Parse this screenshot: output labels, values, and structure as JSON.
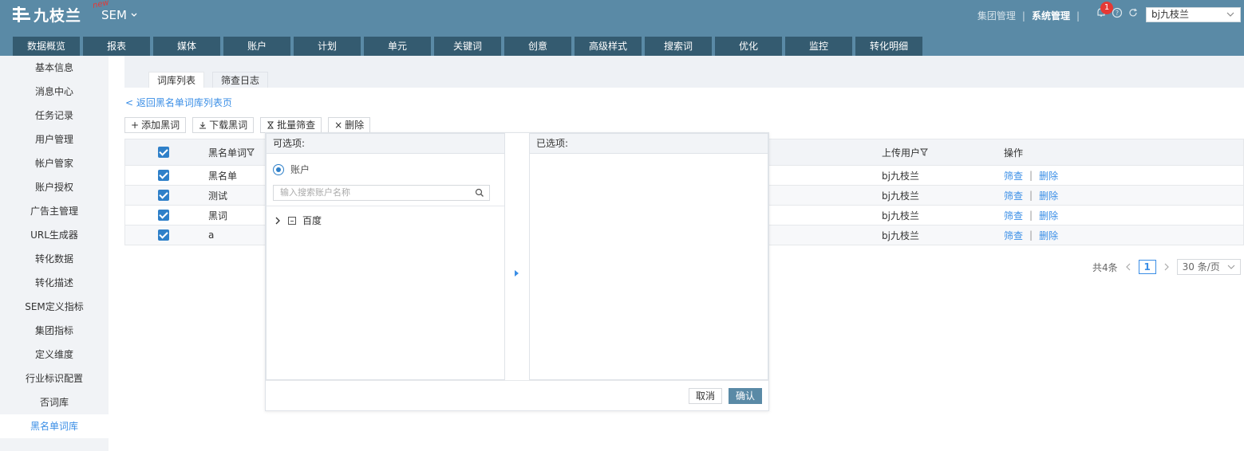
{
  "header": {
    "logo_text": "九枝兰",
    "new_tag": "new",
    "product": "SEM",
    "links": [
      "集团管理",
      "系统管理"
    ],
    "notification_count": "1",
    "user": "bj九枝兰"
  },
  "nav": [
    "数据概览",
    "报表",
    "媒体",
    "账户",
    "计划",
    "单元",
    "关键词",
    "创意",
    "高级样式",
    "搜索词",
    "优化",
    "监控",
    "转化明细"
  ],
  "sidebar": [
    "基本信息",
    "消息中心",
    "任务记录",
    "用户管理",
    "帐户管家",
    "账户授权",
    "广告主管理",
    "URL生成器",
    "转化数据",
    "转化描述",
    "SEM定义指标",
    "集团指标",
    "定义维度",
    "行业标识配置",
    "否词库",
    "黑名单词库"
  ],
  "subtabs": [
    "词库列表",
    "筛查日志"
  ],
  "back_link": "< 返回黑名单词库列表页",
  "actions": [
    "添加黑词",
    "下载黑词",
    "批量筛查",
    "删除"
  ],
  "table": {
    "headers": [
      "黑名单词",
      "上传用户",
      "操作"
    ],
    "rows": [
      {
        "word": "黑名单",
        "user": "bj九枝兰"
      },
      {
        "word": "测试",
        "user": "bj九枝兰"
      },
      {
        "word": "黑词",
        "user": "bj九枝兰"
      },
      {
        "word": "a",
        "user": "bj九枝兰"
      }
    ],
    "op_screen": "筛查",
    "op_delete": "删除"
  },
  "pager": {
    "total": "共4条",
    "page": "1",
    "page_size": "30 条/页"
  },
  "modal": {
    "available_title": "可选项:",
    "selected_title": "已选项:",
    "radio_label": "账户",
    "search_placeholder": "输入搜索账户名称",
    "tree_item": "百度",
    "cancel": "取消",
    "confirm": "确认"
  }
}
